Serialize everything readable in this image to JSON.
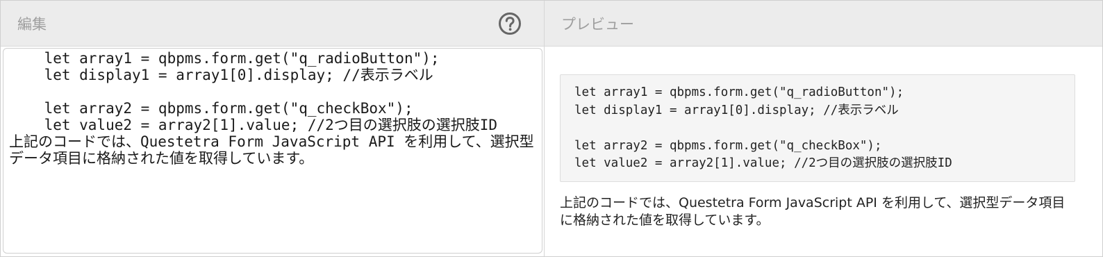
{
  "editor_pane": {
    "title": "編集",
    "help_icon": "question-circle-icon",
    "code_lines": [
      "    let array1 = qbpms.form.get(\"q_radioButton\");",
      "    let display1 = array1[0].display; //表示ラベル",
      "",
      "    let array2 = qbpms.form.get(\"q_checkBox\");",
      "    let value2 = array2[1].value; //2つ目の選択肢の選択肢ID"
    ],
    "paragraph": "上記のコードでは、Questetra Form JavaScript API を利用して、選択型データ項目に格納された値を取得しています。"
  },
  "preview_pane": {
    "title": "プレビュー",
    "code_lines": [
      "let array1 = qbpms.form.get(\"q_radioButton\");",
      "let display1 = array1[0].display; //表示ラベル",
      "",
      "let array2 = qbpms.form.get(\"q_checkBox\");",
      "let value2 = array2[1].value; //2つ目の選択肢の選択肢ID"
    ],
    "paragraph": "上記のコードでは、Questetra Form JavaScript API を利用して、選択型データ項目に格納された値を取得しています。"
  },
  "colors": {
    "header_bg": "#ececec",
    "title_text": "#9e9e9e",
    "help_icon": "#666666",
    "code_bg": "#f5f5f5"
  }
}
